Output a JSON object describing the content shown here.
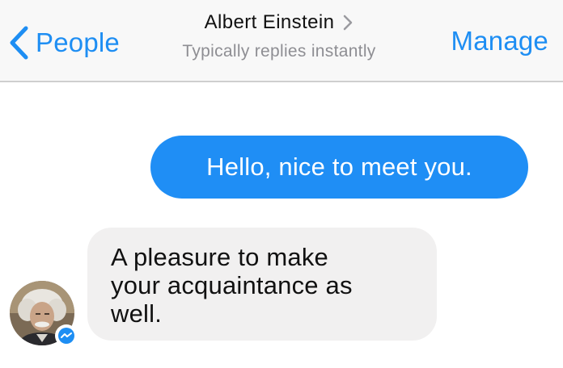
{
  "nav": {
    "back_label": "People",
    "contact_name": "Albert Einstein",
    "subtitle": "Typically replies instantly",
    "manage_label": "Manage",
    "back_icon": "chevron-left-icon",
    "title_icon": "chevron-right-icon"
  },
  "messages": [
    {
      "direction": "outgoing",
      "text": "Hello, nice to meet you."
    },
    {
      "direction": "incoming",
      "text": "A pleasure to make your acquaintance as well."
    }
  ],
  "incoming_lines": [
    "A pleasure to make",
    "your acquaintance as",
    "well."
  ],
  "avatar": {
    "icon": "messenger-icon"
  },
  "colors": {
    "accent": "#1e8ef3",
    "outgoing_bubble": "#1f8ef5",
    "incoming_bubble": "#f1f0f0",
    "subtitle": "#8e8e93"
  }
}
